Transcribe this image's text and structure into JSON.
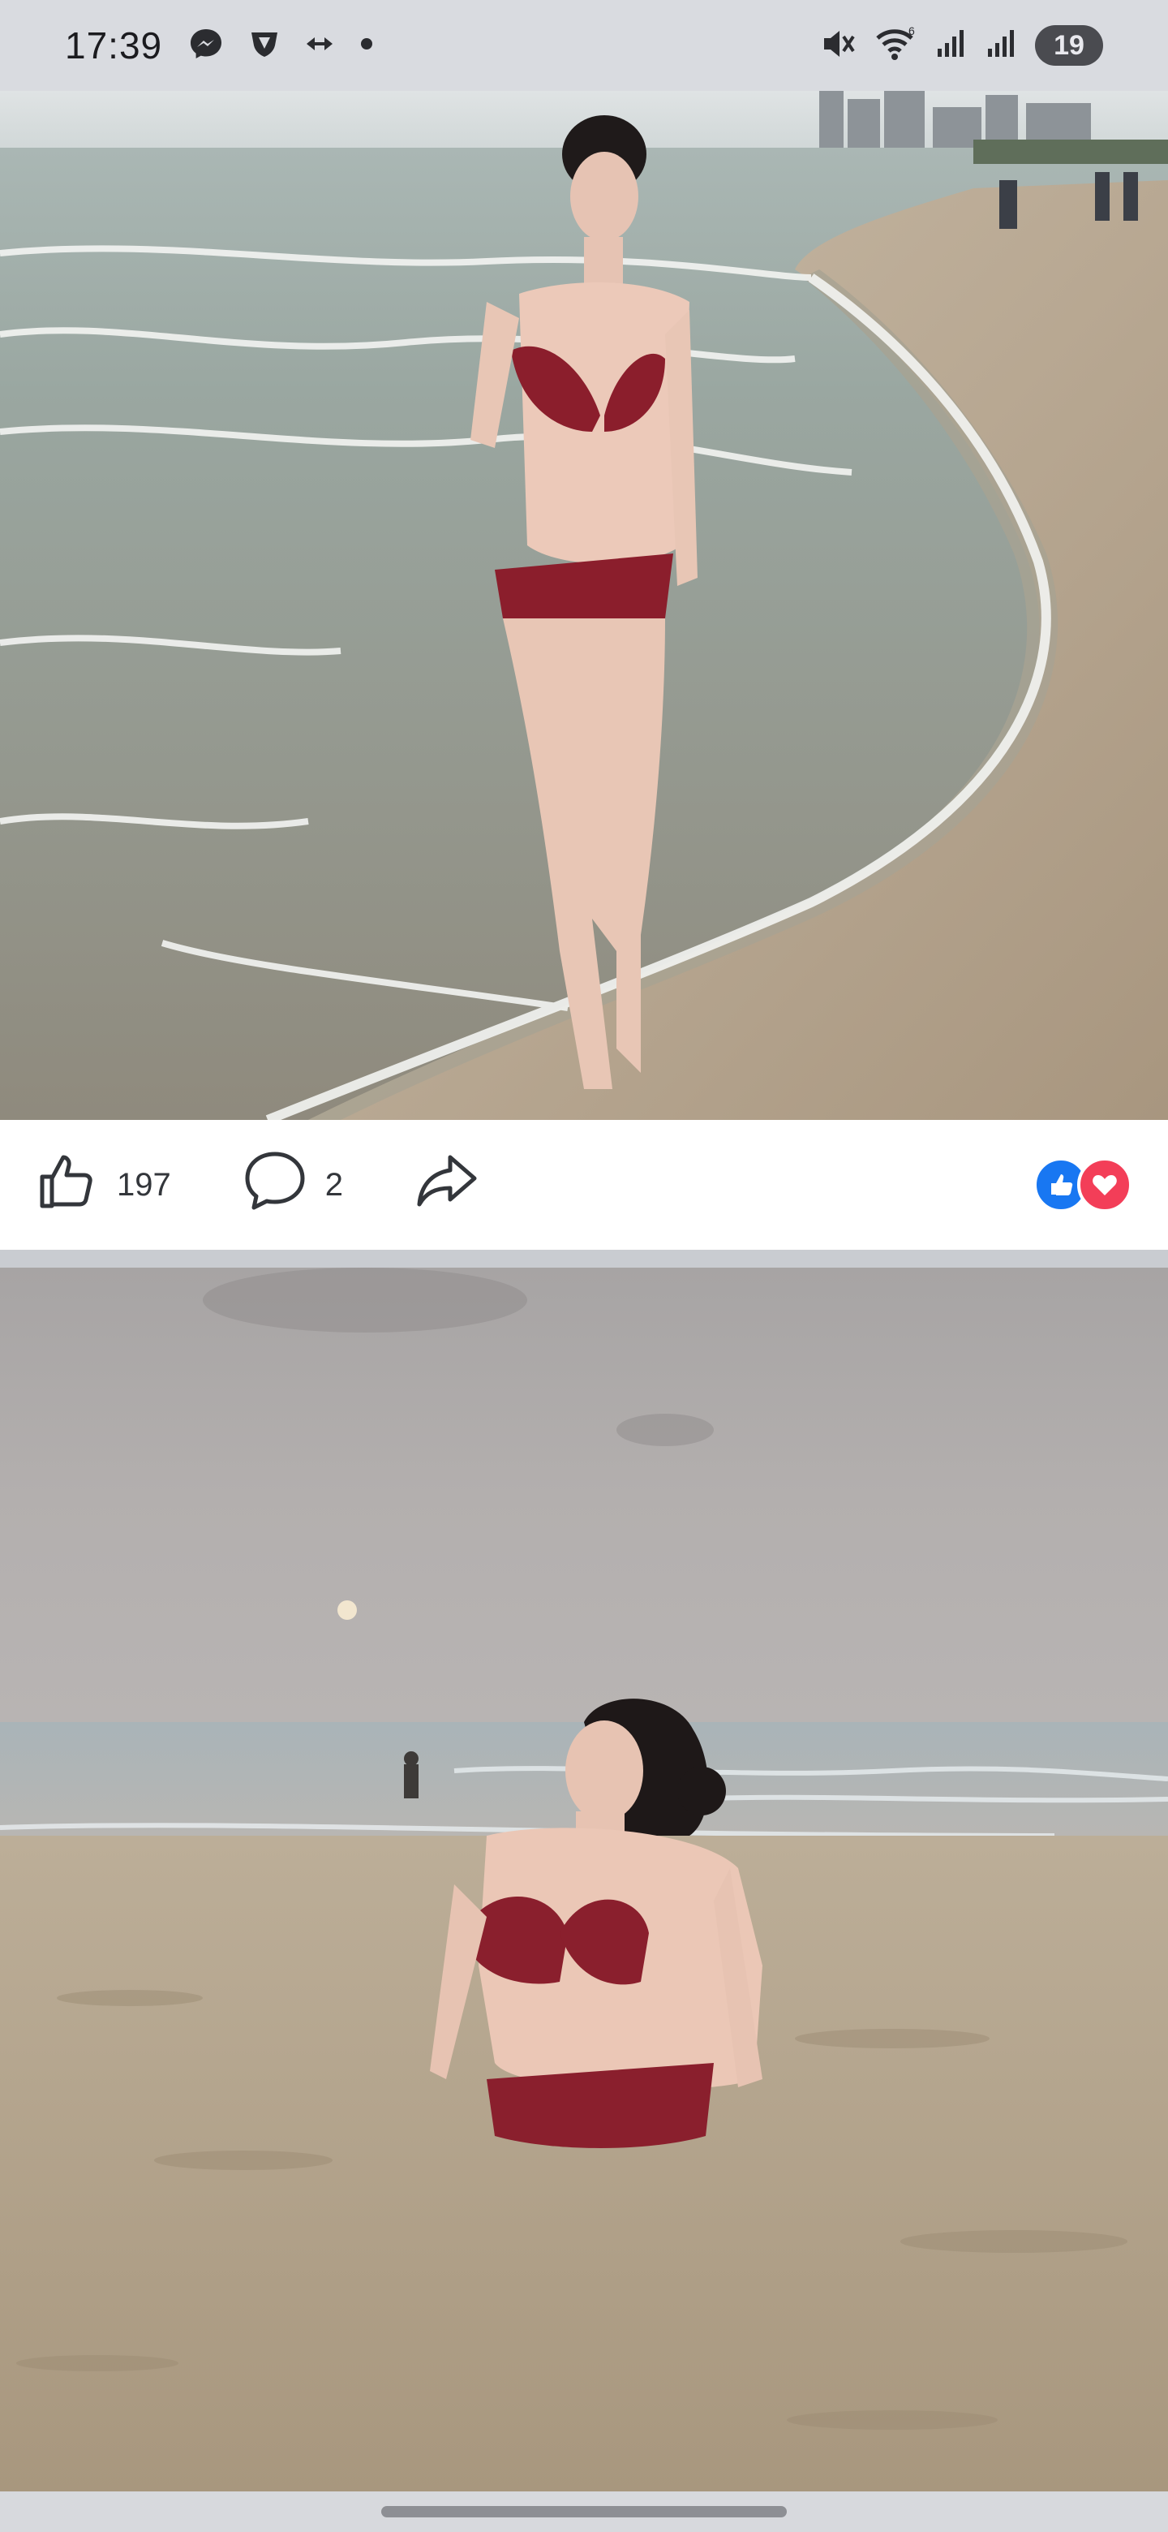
{
  "status_bar": {
    "time": "17:39",
    "battery_level": "19",
    "icons": [
      "messenger-icon",
      "vpn-shield-icon",
      "data-transfer-icon",
      "dot-icon",
      "mute-icon",
      "wifi-icon",
      "signal-icon",
      "signal-icon",
      "battery-icon"
    ],
    "wifi_badge": "6"
  },
  "post_1": {
    "photo_subject": "photo",
    "likes_count": "197",
    "comments_count": "2",
    "icons": [
      "like-icon",
      "comment-icon",
      "share-icon"
    ],
    "reactions": [
      "like-reaction-icon",
      "love-reaction-icon"
    ],
    "colors": {
      "like": "#1877f2",
      "love": "#f33e58"
    }
  },
  "post_2": {
    "photo_subject": "photo"
  }
}
